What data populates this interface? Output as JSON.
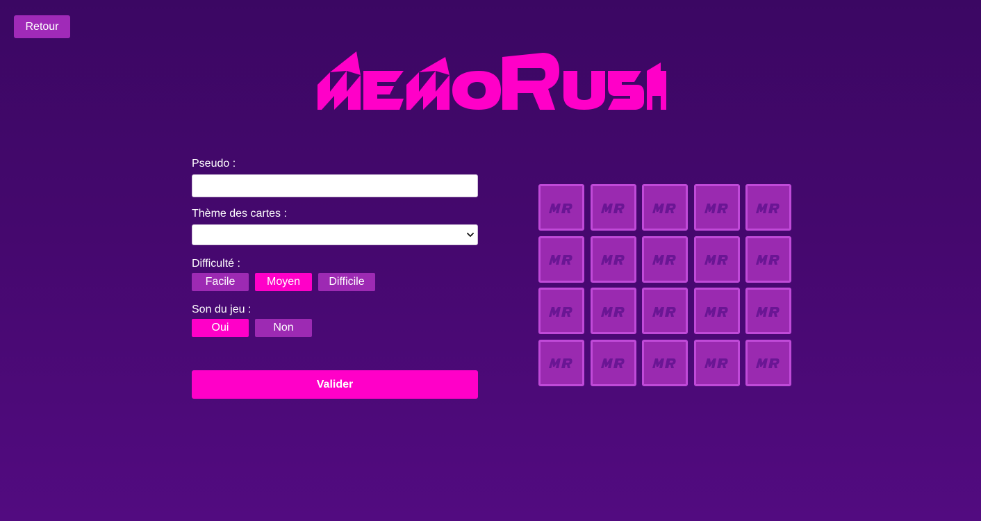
{
  "header": {
    "back_label": "Retour",
    "logo_text": "MEMORUSH"
  },
  "form": {
    "pseudo_label": "Pseudo :",
    "pseudo_value": "",
    "theme_label": "Thème des cartes :",
    "theme_selected": "",
    "difficulty_label": "Difficulté :",
    "difficulty_options": [
      "Facile",
      "Moyen",
      "Difficile"
    ],
    "difficulty_selected": "Moyen",
    "sound_label": "Son du jeu :",
    "sound_options": [
      "Oui",
      "Non"
    ],
    "sound_selected": "Oui",
    "submit_label": "Valider"
  },
  "cards": {
    "rows": 4,
    "columns": 5,
    "back_text": "MR"
  },
  "colors": {
    "accent": "#ff00c8",
    "button_inactive": "#9d2ab3",
    "card_face": "#9a2ab0",
    "card_border": "#c04ad8",
    "background_top": "#3b0763",
    "background_bottom": "#520b80"
  }
}
